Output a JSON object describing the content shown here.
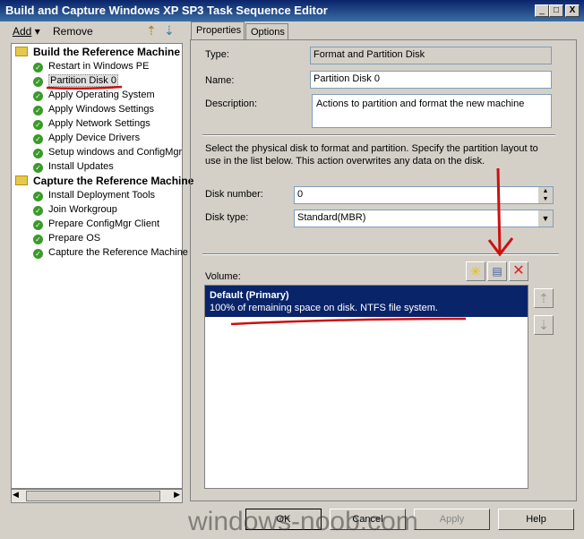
{
  "window": {
    "title": "Build and Capture Windows XP SP3 Task Sequence Editor",
    "min": "_",
    "max": "□",
    "close": "X"
  },
  "toolbar": {
    "add": "Add",
    "remove": "Remove"
  },
  "tree": {
    "groups": [
      {
        "label": "Build the Reference Machine",
        "items": [
          "Restart in Windows PE",
          "Partition Disk 0",
          "Apply Operating System",
          "Apply Windows Settings",
          "Apply Network Settings",
          "Apply Device Drivers",
          "Setup windows and ConfigMgr",
          "Install Updates"
        ]
      },
      {
        "label": "Capture the Reference Machine",
        "items": [
          "Install Deployment Tools",
          "Join Workgroup",
          "Prepare ConfigMgr Client",
          "Prepare OS",
          "Capture the Reference Machine"
        ]
      }
    ],
    "selected": "Partition Disk 0"
  },
  "tabs": [
    "Properties",
    "Options"
  ],
  "props": {
    "type_label": "Type:",
    "type_value": "Format and Partition Disk",
    "name_label": "Name:",
    "name_value": "Partition Disk 0",
    "desc_label": "Description:",
    "desc_value": "Actions to partition and format the new machine",
    "info": "Select the physical disk to format and partition. Specify the partition layout to use in the list below. This action overwrites any data on the disk.",
    "disk_number_label": "Disk number:",
    "disk_number": "0",
    "disk_type_label": "Disk type:",
    "disk_type": "Standard(MBR)",
    "volume_label": "Volume:",
    "volume": {
      "title": "Default (Primary)",
      "detail": "100% of remaining space on disk. NTFS file system."
    }
  },
  "buttons": {
    "ok": "OK",
    "cancel": "Cancel",
    "apply": "Apply",
    "help": "Help"
  },
  "watermark": "windows-noob.com",
  "colors": {
    "selection": "#0a246a",
    "annotation": "#cc1010"
  }
}
